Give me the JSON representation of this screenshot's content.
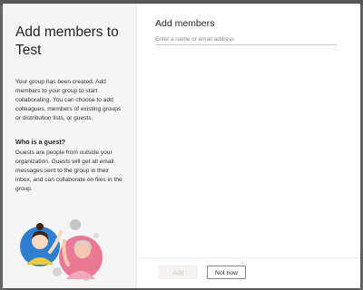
{
  "dialog": {
    "title": "Add members to Test",
    "intro": "Your group has been created. Add members to your group to start collaborating. You can choose to add colleagues, members of existing groups or distribution lists, or guests.",
    "guest_heading": "Who is a guest?",
    "guest_text": "Guests are people from outside your organization. Guests will get all email messages sent to the group in their inbox, and can collaborate on files in the group."
  },
  "add_members": {
    "title": "Add members",
    "placeholder": "Enter a name or email address",
    "value": ""
  },
  "footer": {
    "add_label": "Add",
    "add_enabled": false,
    "not_now_label": "Not now"
  },
  "colors": {
    "panel_bg": "#f5f5f5",
    "illustration_blue": "#2f7fd0",
    "illustration_pink": "#e97995",
    "illustration_yellow": "#f0c93a"
  }
}
